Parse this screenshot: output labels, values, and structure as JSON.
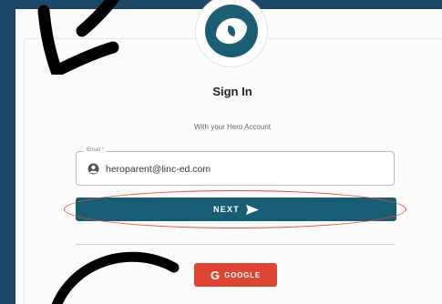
{
  "signin": {
    "title": "Sign In",
    "subtitle": "With your Hero Account",
    "email_label": "Email *",
    "email_value": "heroparent@linc-ed.com",
    "next_label": "NEXT",
    "google_label": "GOOGLE",
    "google_glyph": "G"
  },
  "colors": {
    "background": "#1c4766",
    "primary": "#175e74",
    "google": "#df4533",
    "highlight": "#e84848"
  },
  "icons": {
    "logo": "hero-logo-icon",
    "email": "account-circle-icon",
    "next": "send-arrow-icon"
  }
}
